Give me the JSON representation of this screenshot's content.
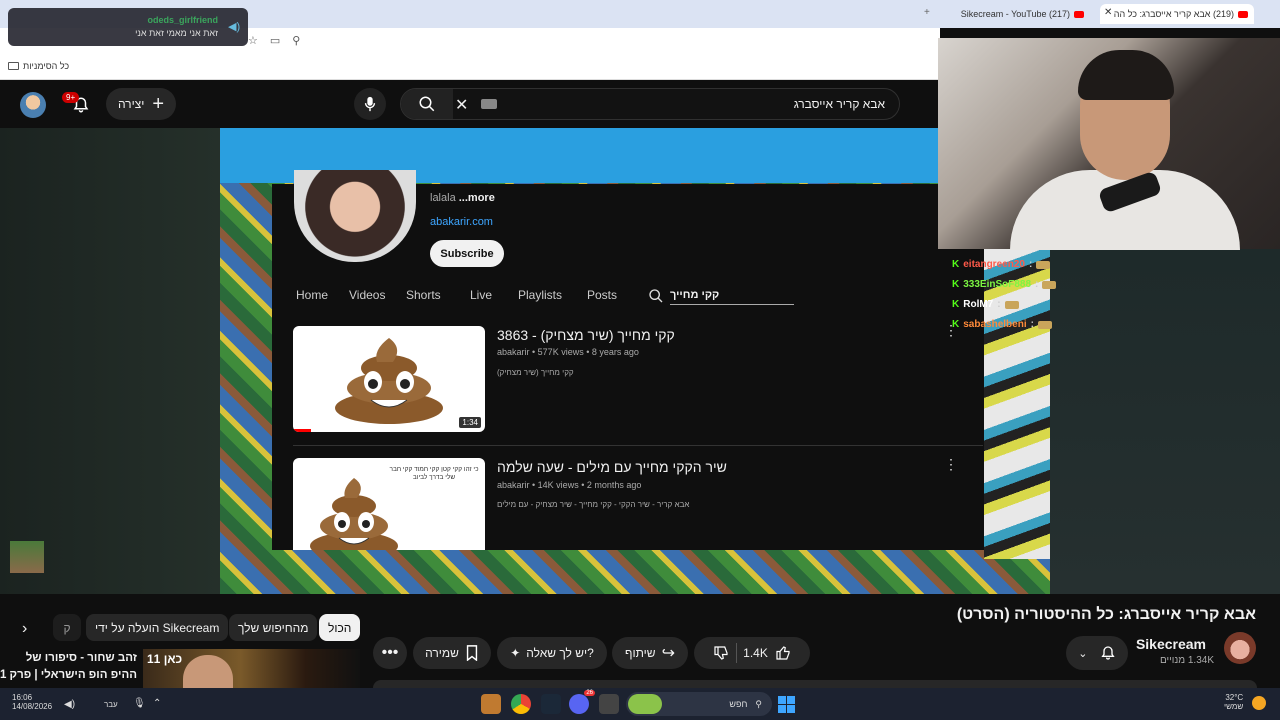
{
  "browser": {
    "tabs": [
      {
        "title": "(219) אבא קריר אייסברג: כל הה",
        "active": true
      },
      {
        "title": "(217) Sikecream - YouTube",
        "active": false
      }
    ],
    "bookmarks_label": "כל הסימניות"
  },
  "discord_overlay": {
    "username": "odeds_girlfriend",
    "message": "זאת אני מאמי זאת אני"
  },
  "topbar": {
    "notification_count": "9+",
    "create_label": "יצירה",
    "search_query": "אבא קריר אייסברג"
  },
  "channel_page": {
    "description": "lalala",
    "more": "...more",
    "link": "abakarir.com",
    "subscribe_label": "Subscribe",
    "tabs": [
      "Home",
      "Videos",
      "Shorts",
      "Live",
      "Playlists",
      "Posts"
    ],
    "search_text": "קקי מחייך",
    "videos": [
      {
        "title": "קקי מחייך (שיר מצחיק) - 3863",
        "channel": "abakarir",
        "meta": "577K views • 8 years ago",
        "desc": "קקי מחייך (שיר מצחיק)",
        "duration": "1:34"
      },
      {
        "title": "שיר הקקי מחייך עם מילים - שעה שלמה",
        "channel": "abakarir",
        "meta": "14K views • 2 months ago",
        "desc": "אבא קריר - שיר הקקי - קקי מחייך - שיר מצחיק - עם מילים",
        "thumb_caption": "כי זהו קקי קטן קקי חמוד קקי חבר שלי בדרך לביוב"
      }
    ]
  },
  "chat": [
    {
      "user": "eitangreen20",
      "color": "#ff5a4a"
    },
    {
      "user": "333EinSoF888",
      "color": "#7cf542"
    },
    {
      "user": "RolM7",
      "color": "#ffffff"
    },
    {
      "user": "sabashelbeni",
      "color": "#ff8a3a"
    }
  ],
  "video": {
    "title": "אבא קריר אייסברג: כל ההיסטוריה (הסרט)",
    "channel_name": "Sikecream",
    "subscribers": "1.34K מנויים",
    "likes": "1.4K",
    "share_label": "שיתוף",
    "ask_label": "יש לך שאלה?",
    "save_label": "שמירה"
  },
  "chips": {
    "all": "הכול",
    "from_search": "מהחיפוש שלך",
    "uploaded_by": "הועלה על ידי Sikecream",
    "partial": "ק"
  },
  "recommendation": {
    "title": "זהב שחור - סיפורו של ההיפ הופ הישראלי | פרק 1",
    "logo": "כאן 11"
  },
  "taskbar": {
    "time": "16:06",
    "date": "14/08/2026",
    "lang": "עבר",
    "search_label": "חפש",
    "weather_temp": "32°C",
    "weather_desc": "שמשי",
    "discord_badge": "26"
  }
}
